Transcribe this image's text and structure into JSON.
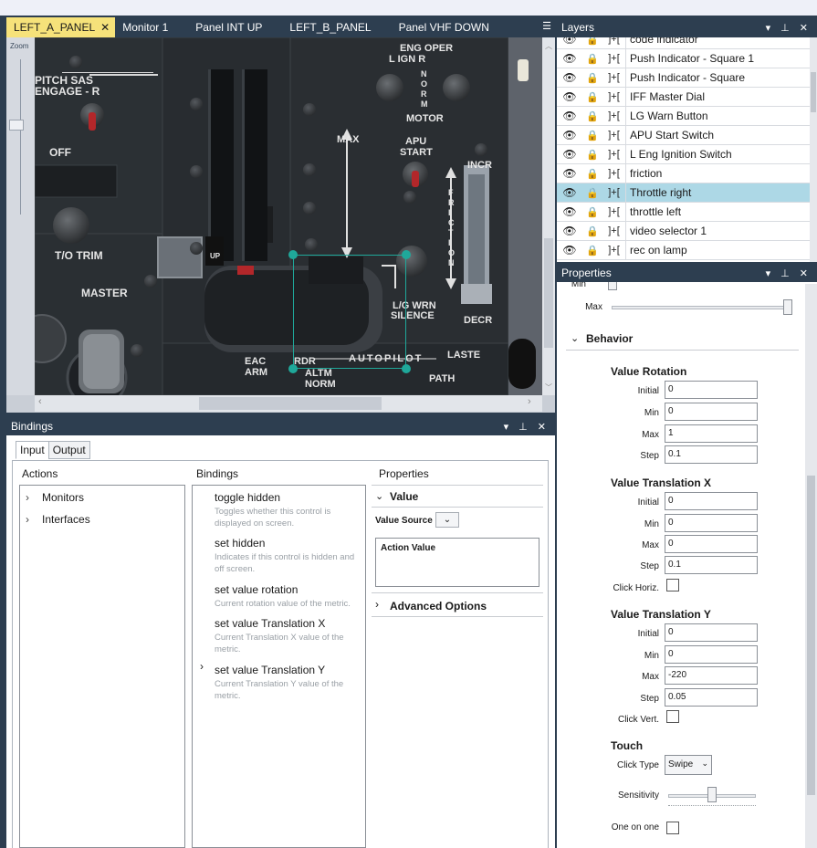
{
  "doc_tabs": [
    {
      "label": "LEFT_A_PANEL",
      "active": true
    },
    {
      "label": "Monitor 1"
    },
    {
      "label": "Panel INT UP"
    },
    {
      "label": "LEFT_B_PANEL"
    },
    {
      "label": "Panel VHF DOWN"
    }
  ],
  "canvas": {
    "zoom_label": "Zoom",
    "panel_text": {
      "pitch_sas": "PITCH SAS",
      "engage": "ENGAGE - R",
      "off": "OFF",
      "eng_oper": "ENG OPER",
      "l_ign_r": "L   IGN   R",
      "norm_letters": [
        "N",
        "O",
        "R",
        "M"
      ],
      "motor": "MOTOR",
      "max": "MAX",
      "apu": "APU",
      "start": "START",
      "incr": "INCR",
      "friction_letters": [
        "F",
        "R",
        "I",
        "C",
        "T",
        "I",
        "O",
        "N"
      ],
      "t_o_trim": "T/O TRIM",
      "up": "UP",
      "master": "MASTER",
      "lg_wrn": "L/G WRN",
      "silence": "SILENCE",
      "decr": "DECR",
      "eac": "EAC",
      "arm": "ARM",
      "rdr": "RDR",
      "altm": "ALTM",
      "norm": "NORM",
      "autopilot": "AUTOPILOT",
      "laste": "LASTE",
      "path": "PATH"
    }
  },
  "layers": {
    "title": "Layers",
    "items": [
      {
        "label": "code indicator"
      },
      {
        "label": "Push Indicator - Square 1"
      },
      {
        "label": "Push Indicator - Square"
      },
      {
        "label": "IFF Master Dial"
      },
      {
        "label": "LG Warn Button"
      },
      {
        "label": "APU Start Switch"
      },
      {
        "label": "L Eng Ignition Switch"
      },
      {
        "label": "friction"
      },
      {
        "label": "Throttle right",
        "selected": true
      },
      {
        "label": "throttle left"
      },
      {
        "label": "video selector 1"
      },
      {
        "label": "rec on lamp"
      }
    ]
  },
  "properties": {
    "title": "Properties",
    "partial_min": "Min",
    "partial_max": "Max",
    "behavior": "Behavior",
    "value_rotation": {
      "title": "Value Rotation",
      "initial": "0",
      "min": "0",
      "max": "1",
      "step": "0.1"
    },
    "value_translation_x": {
      "title": "Value Translation X",
      "initial": "0",
      "min": "0",
      "max": "0",
      "step": "0.1",
      "click_label": "Click Horiz."
    },
    "value_translation_y": {
      "title": "Value Translation Y",
      "initial": "0",
      "min": "0",
      "max": "-220",
      "step": "0.05",
      "click_label": "Click Vert."
    },
    "labels": {
      "initial": "Initial",
      "min": "Min",
      "max": "Max",
      "step": "Step"
    },
    "touch": {
      "title": "Touch",
      "click_type_label": "Click Type",
      "click_type": "Swipe",
      "sensitivity_label": "Sensitivity",
      "one_on_one_label": "One on one"
    }
  },
  "bindings": {
    "title": "Bindings",
    "tabs": [
      "Input",
      "Output"
    ],
    "col_actions": "Actions",
    "col_bindings": "Bindings",
    "col_properties": "Properties",
    "actions": [
      "Monitors",
      "Interfaces"
    ],
    "items": [
      {
        "title": "toggle hidden",
        "desc": "Toggles whether this control is displayed on screen."
      },
      {
        "title": "set hidden",
        "desc": "Indicates if this control is hidden and off screen."
      },
      {
        "title": "set value rotation",
        "desc": "Current rotation value of the metric."
      },
      {
        "title": "set value Translation X",
        "desc": "Current Translation X value of the metric."
      },
      {
        "title": "set value Translation Y",
        "desc": "Current Translation Y value of the metric."
      }
    ],
    "value_section": "Value",
    "value_source_label": "Value Source",
    "action_value_label": "Action Value",
    "advanced_options": "Advanced Options"
  },
  "colors": {
    "chrome": "#2d3e50",
    "active_tab": "#f6e27a",
    "selection": "#add8e6",
    "handle": "#1fa89a"
  }
}
